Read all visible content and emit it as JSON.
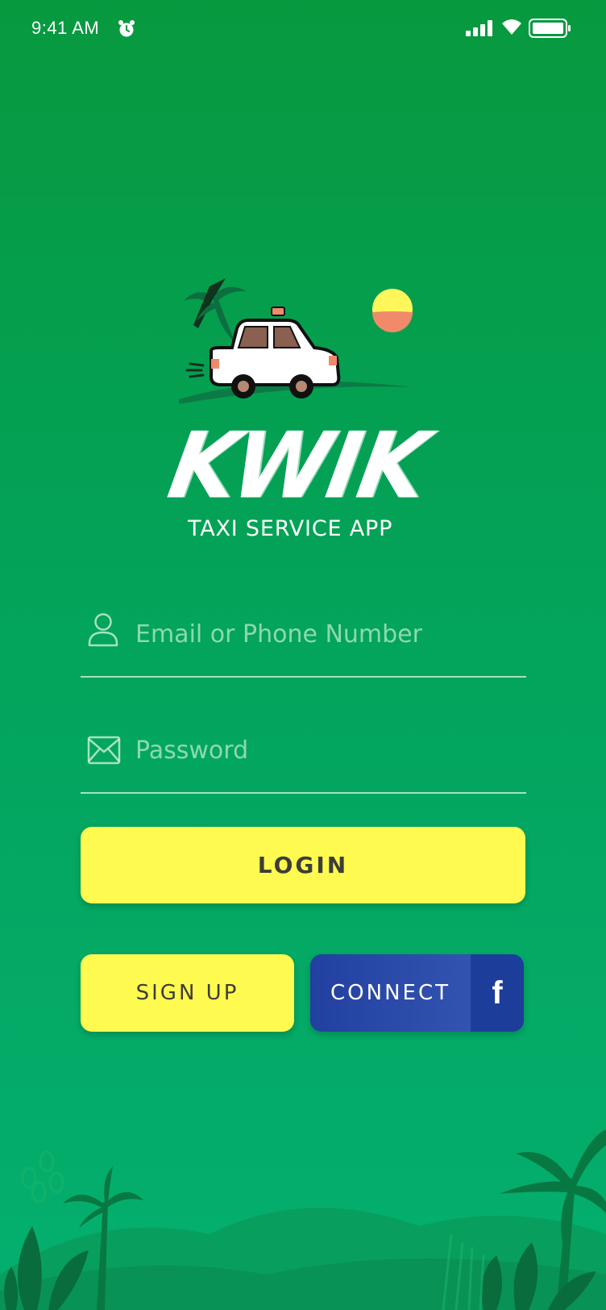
{
  "status_bar": {
    "time": "9:41 AM",
    "icons": [
      "alarm-icon",
      "signal-icon",
      "wifi-icon",
      "battery-icon"
    ]
  },
  "logo": {
    "wordmark": "KWIK",
    "tagline": "TAXI SERVICE APP"
  },
  "form": {
    "email": {
      "placeholder": "Email or Phone Number",
      "value": "",
      "icon": "user-icon"
    },
    "password": {
      "placeholder": "Password",
      "value": "",
      "icon": "envelope-icon"
    }
  },
  "buttons": {
    "login": "LOGIN",
    "signup": "SIGN UP",
    "facebook_connect": "CONNECT",
    "facebook_glyph": "f"
  },
  "colors": {
    "background_top": "#07993e",
    "background_bottom": "#04af6f",
    "accent_yellow": "#fffa4f",
    "facebook_blue": "#2140a0",
    "button_text": "#3d3d38"
  }
}
